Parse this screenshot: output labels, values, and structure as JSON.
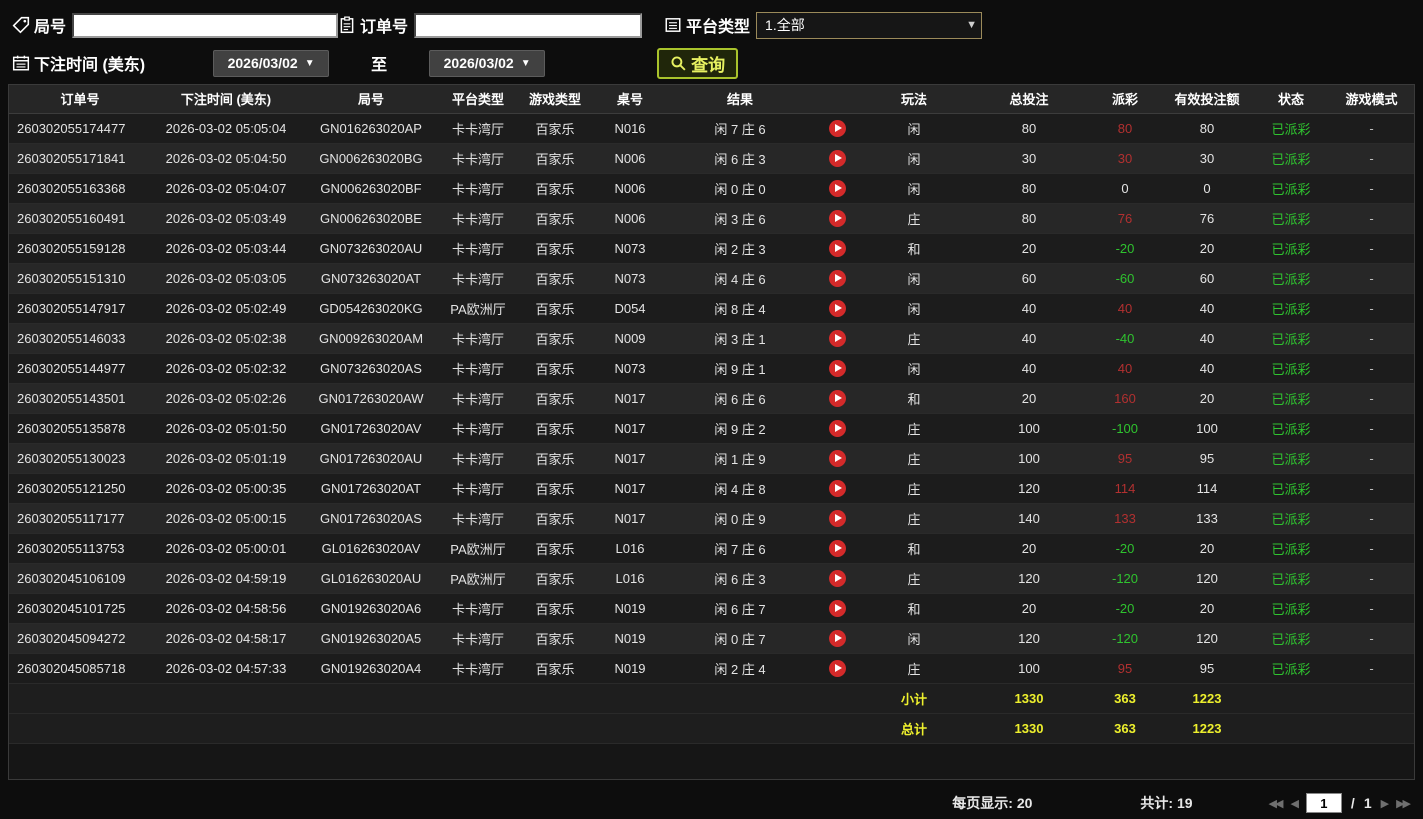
{
  "filters": {
    "round_label": "局号",
    "order_label": "订单号",
    "platform_label": "平台类型",
    "platform_value": "1.全部",
    "bet_time_label": "下注时间 (美东)",
    "date_from": "2026/03/02",
    "date_to": "2026/03/02",
    "to_label": "至",
    "query_label": "查询"
  },
  "icons": {
    "dropdown": "▼",
    "first": "◀◀",
    "prev": "◀",
    "next": "▶",
    "last": "▶▶"
  },
  "table": {
    "headers": [
      "订单号",
      "下注时间 (美东)",
      "局号",
      "平台类型",
      "游戏类型",
      "桌号",
      "结果",
      "",
      "玩法",
      "总投注",
      "派彩",
      "有效投注额",
      "状态",
      "游戏模式"
    ],
    "rows": [
      {
        "order_id": "260302055174477",
        "bet_time": "2026-03-02 05:05:04",
        "round_id": "GN016263020AP",
        "platform": "卡卡湾厅",
        "game_type": "百家乐",
        "table_no": "N016",
        "result": "闲 7 庄 6",
        "play_type": "闲",
        "total_bet": "80",
        "payout": "80",
        "payout_class": "pos",
        "valid_bet": "80",
        "status": "已派彩",
        "mode": "-"
      },
      {
        "order_id": "260302055171841",
        "bet_time": "2026-03-02 05:04:50",
        "round_id": "GN006263020BG",
        "platform": "卡卡湾厅",
        "game_type": "百家乐",
        "table_no": "N006",
        "result": "闲 6 庄 3",
        "play_type": "闲",
        "total_bet": "30",
        "payout": "30",
        "payout_class": "pos",
        "valid_bet": "30",
        "status": "已派彩",
        "mode": "-"
      },
      {
        "order_id": "260302055163368",
        "bet_time": "2026-03-02 05:04:07",
        "round_id": "GN006263020BF",
        "platform": "卡卡湾厅",
        "game_type": "百家乐",
        "table_no": "N006",
        "result": "闲 0 庄 0",
        "play_type": "闲",
        "total_bet": "80",
        "payout": "0",
        "payout_class": "zero",
        "valid_bet": "0",
        "status": "已派彩",
        "mode": "-"
      },
      {
        "order_id": "260302055160491",
        "bet_time": "2026-03-02 05:03:49",
        "round_id": "GN006263020BE",
        "platform": "卡卡湾厅",
        "game_type": "百家乐",
        "table_no": "N006",
        "result": "闲 3 庄 6",
        "play_type": "庄",
        "total_bet": "80",
        "payout": "76",
        "payout_class": "pos",
        "valid_bet": "76",
        "status": "已派彩",
        "mode": "-"
      },
      {
        "order_id": "260302055159128",
        "bet_time": "2026-03-02 05:03:44",
        "round_id": "GN073263020AU",
        "platform": "卡卡湾厅",
        "game_type": "百家乐",
        "table_no": "N073",
        "result": "闲 2 庄 3",
        "play_type": "和",
        "total_bet": "20",
        "payout": "-20",
        "payout_class": "neg",
        "valid_bet": "20",
        "status": "已派彩",
        "mode": "-"
      },
      {
        "order_id": "260302055151310",
        "bet_time": "2026-03-02 05:03:05",
        "round_id": "GN073263020AT",
        "platform": "卡卡湾厅",
        "game_type": "百家乐",
        "table_no": "N073",
        "result": "闲 4 庄 6",
        "play_type": "闲",
        "total_bet": "60",
        "payout": "-60",
        "payout_class": "neg",
        "valid_bet": "60",
        "status": "已派彩",
        "mode": "-"
      },
      {
        "order_id": "260302055147917",
        "bet_time": "2026-03-02 05:02:49",
        "round_id": "GD054263020KG",
        "platform": "PA欧洲厅",
        "game_type": "百家乐",
        "table_no": "D054",
        "result": "闲 8 庄 4",
        "play_type": "闲",
        "total_bet": "40",
        "payout": "40",
        "payout_class": "pos",
        "valid_bet": "40",
        "status": "已派彩",
        "mode": "-"
      },
      {
        "order_id": "260302055146033",
        "bet_time": "2026-03-02 05:02:38",
        "round_id": "GN009263020AM",
        "platform": "卡卡湾厅",
        "game_type": "百家乐",
        "table_no": "N009",
        "result": "闲 3 庄 1",
        "play_type": "庄",
        "total_bet": "40",
        "payout": "-40",
        "payout_class": "neg",
        "valid_bet": "40",
        "status": "已派彩",
        "mode": "-"
      },
      {
        "order_id": "260302055144977",
        "bet_time": "2026-03-02 05:02:32",
        "round_id": "GN073263020AS",
        "platform": "卡卡湾厅",
        "game_type": "百家乐",
        "table_no": "N073",
        "result": "闲 9 庄 1",
        "play_type": "闲",
        "total_bet": "40",
        "payout": "40",
        "payout_class": "pos",
        "valid_bet": "40",
        "status": "已派彩",
        "mode": "-"
      },
      {
        "order_id": "260302055143501",
        "bet_time": "2026-03-02 05:02:26",
        "round_id": "GN017263020AW",
        "platform": "卡卡湾厅",
        "game_type": "百家乐",
        "table_no": "N017",
        "result": "闲 6 庄 6",
        "play_type": "和",
        "total_bet": "20",
        "payout": "160",
        "payout_class": "pos",
        "valid_bet": "20",
        "status": "已派彩",
        "mode": "-"
      },
      {
        "order_id": "260302055135878",
        "bet_time": "2026-03-02 05:01:50",
        "round_id": "GN017263020AV",
        "platform": "卡卡湾厅",
        "game_type": "百家乐",
        "table_no": "N017",
        "result": "闲 9 庄 2",
        "play_type": "庄",
        "total_bet": "100",
        "payout": "-100",
        "payout_class": "neg",
        "valid_bet": "100",
        "status": "已派彩",
        "mode": "-"
      },
      {
        "order_id": "260302055130023",
        "bet_time": "2026-03-02 05:01:19",
        "round_id": "GN017263020AU",
        "platform": "卡卡湾厅",
        "game_type": "百家乐",
        "table_no": "N017",
        "result": "闲 1 庄 9",
        "play_type": "庄",
        "total_bet": "100",
        "payout": "95",
        "payout_class": "pos",
        "valid_bet": "95",
        "status": "已派彩",
        "mode": "-"
      },
      {
        "order_id": "260302055121250",
        "bet_time": "2026-03-02 05:00:35",
        "round_id": "GN017263020AT",
        "platform": "卡卡湾厅",
        "game_type": "百家乐",
        "table_no": "N017",
        "result": "闲 4 庄 8",
        "play_type": "庄",
        "total_bet": "120",
        "payout": "114",
        "payout_class": "pos",
        "valid_bet": "114",
        "status": "已派彩",
        "mode": "-"
      },
      {
        "order_id": "260302055117177",
        "bet_time": "2026-03-02 05:00:15",
        "round_id": "GN017263020AS",
        "platform": "卡卡湾厅",
        "game_type": "百家乐",
        "table_no": "N017",
        "result": "闲 0 庄 9",
        "play_type": "庄",
        "total_bet": "140",
        "payout": "133",
        "payout_class": "pos",
        "valid_bet": "133",
        "status": "已派彩",
        "mode": "-"
      },
      {
        "order_id": "260302055113753",
        "bet_time": "2026-03-02 05:00:01",
        "round_id": "GL016263020AV",
        "platform": "PA欧洲厅",
        "game_type": "百家乐",
        "table_no": "L016",
        "result": "闲 7 庄 6",
        "play_type": "和",
        "total_bet": "20",
        "payout": "-20",
        "payout_class": "neg",
        "valid_bet": "20",
        "status": "已派彩",
        "mode": "-"
      },
      {
        "order_id": "260302045106109",
        "bet_time": "2026-03-02 04:59:19",
        "round_id": "GL016263020AU",
        "platform": "PA欧洲厅",
        "game_type": "百家乐",
        "table_no": "L016",
        "result": "闲 6 庄 3",
        "play_type": "庄",
        "total_bet": "120",
        "payout": "-120",
        "payout_class": "neg",
        "valid_bet": "120",
        "status": "已派彩",
        "mode": "-"
      },
      {
        "order_id": "260302045101725",
        "bet_time": "2026-03-02 04:58:56",
        "round_id": "GN019263020A6",
        "platform": "卡卡湾厅",
        "game_type": "百家乐",
        "table_no": "N019",
        "result": "闲 6 庄 7",
        "play_type": "和",
        "total_bet": "20",
        "payout": "-20",
        "payout_class": "neg",
        "valid_bet": "20",
        "status": "已派彩",
        "mode": "-"
      },
      {
        "order_id": "260302045094272",
        "bet_time": "2026-03-02 04:58:17",
        "round_id": "GN019263020A5",
        "platform": "卡卡湾厅",
        "game_type": "百家乐",
        "table_no": "N019",
        "result": "闲 0 庄 7",
        "play_type": "闲",
        "total_bet": "120",
        "payout": "-120",
        "payout_class": "neg",
        "valid_bet": "120",
        "status": "已派彩",
        "mode": "-"
      },
      {
        "order_id": "260302045085718",
        "bet_time": "2026-03-02 04:57:33",
        "round_id": "GN019263020A4",
        "platform": "卡卡湾厅",
        "game_type": "百家乐",
        "table_no": "N019",
        "result": "闲 2 庄 4",
        "play_type": "庄",
        "total_bet": "100",
        "payout": "95",
        "payout_class": "pos",
        "valid_bet": "95",
        "status": "已派彩",
        "mode": "-"
      }
    ]
  },
  "summary": {
    "rows": [
      {
        "label": "小计",
        "total_bet": "1330",
        "payout": "363",
        "valid_bet": "1223"
      },
      {
        "label": "总计",
        "total_bet": "1330",
        "payout": "363",
        "valid_bet": "1223"
      }
    ]
  },
  "footer": {
    "per_page_label": "每页显示:",
    "per_page_value": "20",
    "total_label": "共计:",
    "total_value": "19",
    "page_value": "1",
    "page_separator": "/",
    "page_total": "1"
  }
}
